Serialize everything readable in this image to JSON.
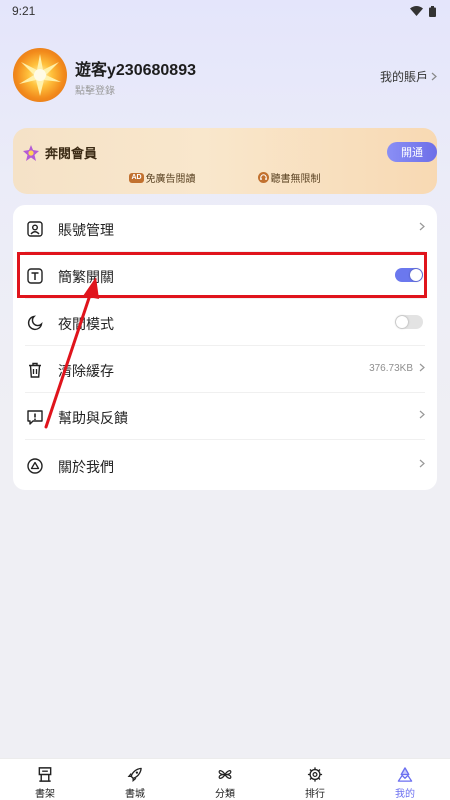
{
  "status_bar": {
    "time": "9:21"
  },
  "profile": {
    "username": "遊客y230680893",
    "login_hint": "點擊登錄",
    "my_account_label": "我的賬戶"
  },
  "vip": {
    "title": "奔閱會員",
    "open_button": "開通",
    "perks": [
      {
        "badge": "AD",
        "label": "免廣告閱讀"
      },
      {
        "badge": "headphone",
        "label": "聽書無限制"
      }
    ]
  },
  "menu": {
    "items": [
      {
        "label": "賬號管理",
        "icon": "person-square-icon",
        "trailing": "chevron"
      },
      {
        "label": "簡繁開關",
        "icon": "text-t-icon",
        "trailing": "toggle",
        "toggle_on": true
      },
      {
        "label": "夜間模式",
        "icon": "moon-icon",
        "trailing": "toggle",
        "toggle_on": false
      },
      {
        "label": "清除緩存",
        "icon": "trash-icon",
        "trailing": "chevron",
        "value": "376.73KB"
      },
      {
        "label": "幫助與反饋",
        "icon": "feedback-icon",
        "trailing": "chevron"
      },
      {
        "label": "關於我們",
        "icon": "about-icon",
        "trailing": "chevron"
      }
    ]
  },
  "bottom_nav": {
    "items": [
      {
        "label": "書架",
        "icon": "bookshelf-icon",
        "active": false
      },
      {
        "label": "書城",
        "icon": "rocket-icon",
        "active": false
      },
      {
        "label": "分類",
        "icon": "category-icon",
        "active": false
      },
      {
        "label": "排行",
        "icon": "gear-rank-icon",
        "active": false
      },
      {
        "label": "我的",
        "icon": "profile-tab-icon",
        "active": true
      }
    ]
  },
  "colors": {
    "accent": "#6b6ff0",
    "toggle_on": "#6b78ee",
    "annotation_red": "#e0141c",
    "vip_gradient_start": "#f5e2c7"
  }
}
